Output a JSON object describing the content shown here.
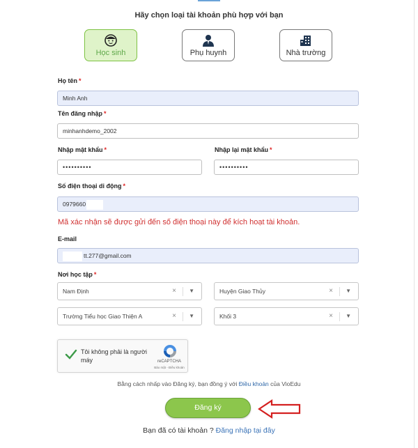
{
  "heading": "Hãy chọn loại tài khoản phù hợp với bạn",
  "account_types": [
    {
      "label": "Học sinh",
      "icon": "student-face-icon",
      "selected": true
    },
    {
      "label": "Phụ huynh",
      "icon": "parent-person-icon",
      "selected": false
    },
    {
      "label": "Nhà trường",
      "icon": "school-building-icon",
      "selected": false
    }
  ],
  "form": {
    "fullname": {
      "label": "Họ tên",
      "required": "*",
      "value": "Minh Anh"
    },
    "username": {
      "label": "Tên đăng nhập",
      "required": "*",
      "value": "minhanhdemo_2002"
    },
    "password": {
      "label": "Nhập mật khẩu",
      "required": "*",
      "value": "••••••••••"
    },
    "password_confirm": {
      "label": "Nhập lại mật khẩu",
      "required": "*",
      "value": "••••••••••"
    },
    "phone": {
      "label": "Số điện thoại di động",
      "required": "*",
      "value": "0979660"
    },
    "phone_notice": "Mã xác nhận sẽ được gửi đến số điện thoại này để kích hoạt tài khoản.",
    "email": {
      "label": "E-mail",
      "value": "tt.277@gmail.com"
    },
    "school": {
      "label": "Nơi học tập",
      "required": "*",
      "province": "Nam Định",
      "district": "Huyện Giao Thủy",
      "school_name": "Trường Tiểu học Giao Thiện A",
      "grade": "Khối 3",
      "clear_glyph": "×",
      "arrow_glyph": "▼"
    }
  },
  "captcha": {
    "text": "Tôi không phải là người máy",
    "brand": "reCAPTCHA",
    "links": "Bảo mật - Điều khoản"
  },
  "terms": {
    "prefix": "Bằng cách nhấp vào Đăng ký, bạn đồng ý với ",
    "link": "Điều khoản",
    "suffix": " của VioEdu"
  },
  "submit_label": "Đăng ký",
  "login": {
    "prefix": "Bạn đã có tài khoản ? ",
    "link": "Đăng nhập tại đây"
  },
  "colors": {
    "accent_green": "#8cc64c",
    "error_red": "#d03030",
    "link_blue": "#3c74b8",
    "annotation_red": "#d42020"
  }
}
